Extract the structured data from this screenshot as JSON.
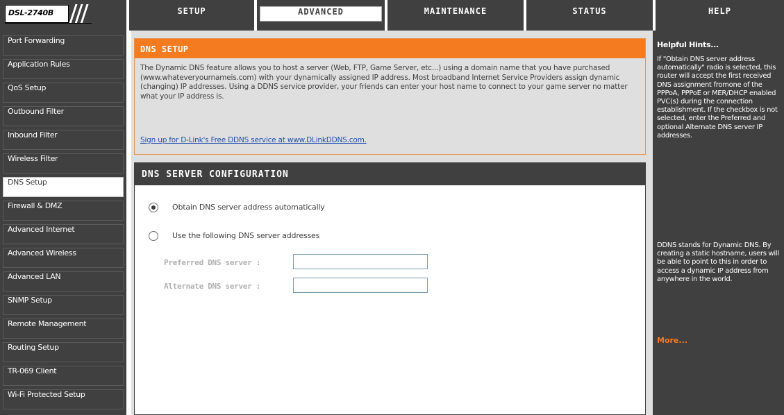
{
  "device": {
    "model": "DSL-2740B"
  },
  "tabs": [
    {
      "label": "SETUP"
    },
    {
      "label": "ADVANCED"
    },
    {
      "label": "MAINTENANCE"
    },
    {
      "label": "STATUS"
    },
    {
      "label": "HELP"
    }
  ],
  "sidebar": {
    "items": [
      {
        "label": "Port Forwarding"
      },
      {
        "label": "Application Rules"
      },
      {
        "label": "QoS Setup"
      },
      {
        "label": "Outbound Filter"
      },
      {
        "label": "Inbound Filter"
      },
      {
        "label": "Wireless Filter"
      },
      {
        "label": "DNS Setup"
      },
      {
        "label": "Firewall & DMZ"
      },
      {
        "label": "Advanced Internet"
      },
      {
        "label": "Advanced Wireless"
      },
      {
        "label": "Advanced LAN"
      },
      {
        "label": "SNMP Setup"
      },
      {
        "label": "Remote Management"
      },
      {
        "label": "Routing Setup"
      },
      {
        "label": "TR-069 Client"
      },
      {
        "label": "Wi-Fi Protected Setup"
      }
    ]
  },
  "intro": {
    "title": "DNS SETUP",
    "text": "The Dynamic DNS feature allows you to host a server (Web, FTP, Game Server, etc...) using a domain name that you have purchased (www.whateveryournameis.com) with your dynamically assigned IP address. Most broadband Internet Service Providers assign dynamic (changing) IP addresses. Using a DDNS service provider, your friends can enter your host name to connect to your game server no matter what your IP address is.",
    "link": "Sign up for D-Link's Free DDNS service at www.DLinkDDNS.com."
  },
  "config": {
    "title": "DNS SERVER CONFIGURATION",
    "option_auto": "Obtain DNS server address automatically",
    "option_manual": "Use the following DNS server addresses",
    "preferred_label": "Preferred DNS server :",
    "alternate_label": "Alternate DNS server :",
    "preferred_value": "",
    "alternate_value": "",
    "selected_option": "auto"
  },
  "help": {
    "title": "Helpful Hints...",
    "para1": "If \"Obtain DNS server address automatically\" radio is selected, this router will accept the first received DNS assignment fromone of the PPPoA, PPPoE or MER/DHCP enabled PVC(s) during the connection establishment. If the checkbox is not selected, enter the Preferred and optional Alternate DNS server IP addresses.",
    "para2": "DDNS stands for Dynamic DNS. By creating a static hostname, users will be able to point to this in order to access a dynamic IP address from anywhere in the world.",
    "more": "More..."
  },
  "colors": {
    "dark": "#404040",
    "accent": "#f47b20",
    "panel": "#dfdfdf",
    "link": "#2050b0"
  }
}
